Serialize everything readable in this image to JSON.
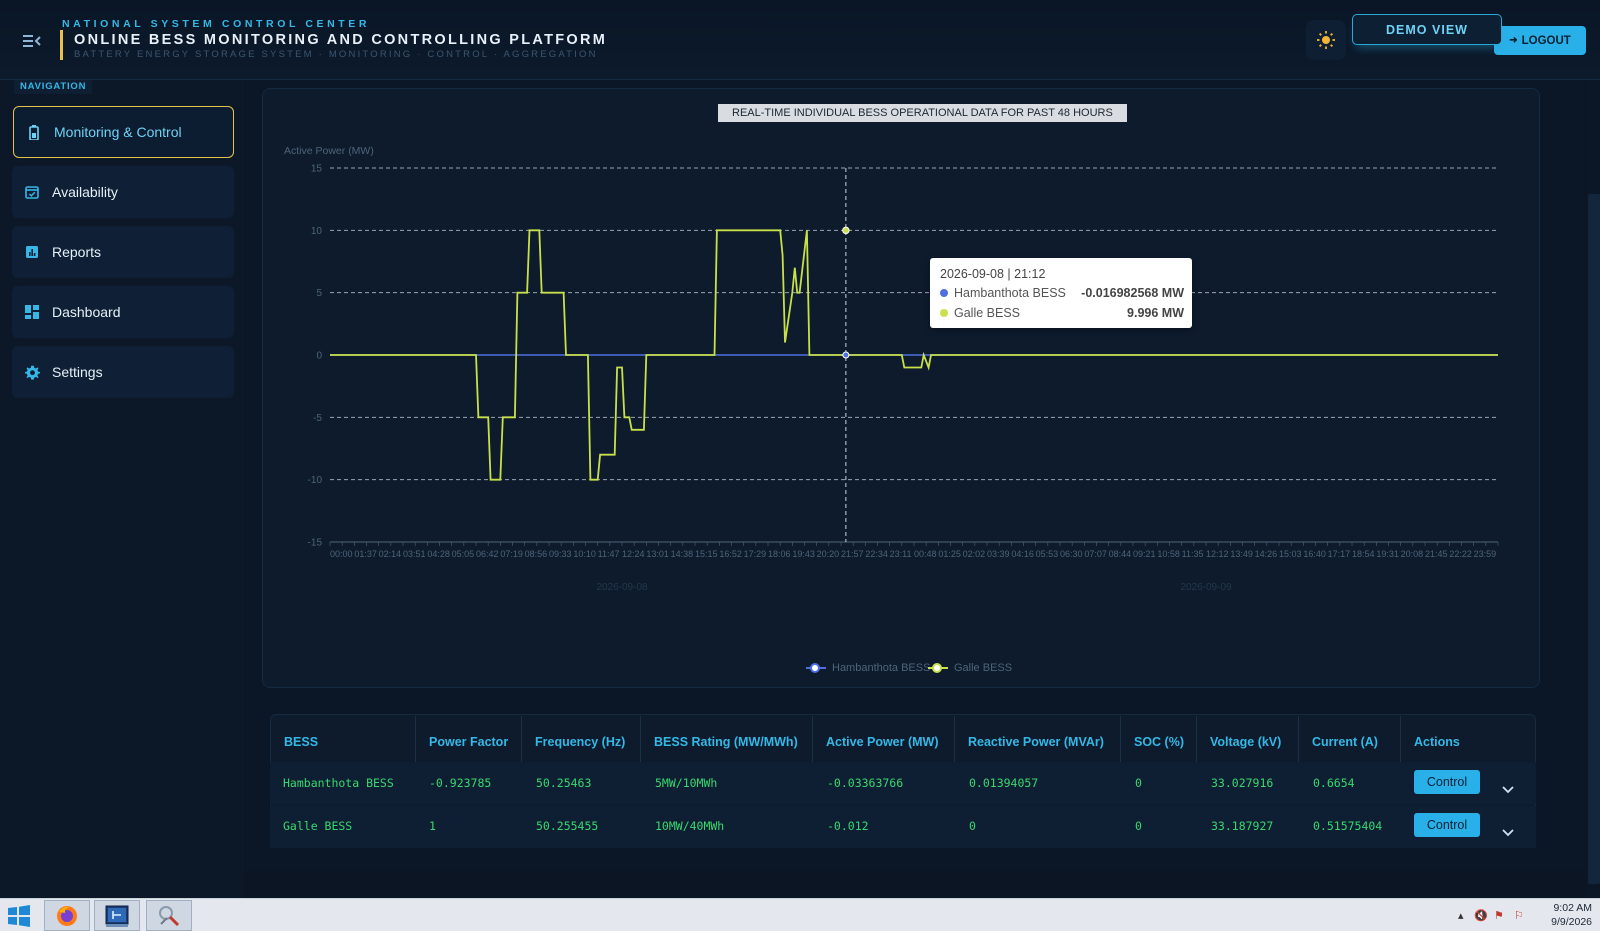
{
  "header": {
    "center_name": "NATIONAL SYSTEM CONTROL CENTER",
    "title": "ONLINE BESS MONITORING AND CONTROLLING PLATFORM",
    "subtitle": "BATTERY ENERGY STORAGE SYSTEM · MONITORING · CONTROL · AGGREGATION",
    "demo_label": "DEMO VIEW",
    "logout_label": "LOGOUT"
  },
  "sidebar": {
    "section_label": "NAVIGATION",
    "items": [
      {
        "label": "Monitoring & Control",
        "icon": "battery-icon",
        "active": true
      },
      {
        "label": "Availability",
        "icon": "calendar-check-icon",
        "active": false
      },
      {
        "label": "Reports",
        "icon": "report-chart-icon",
        "active": false
      },
      {
        "label": "Dashboard",
        "icon": "dashboard-grid-icon",
        "active": false
      },
      {
        "label": "Settings",
        "icon": "gear-icon",
        "active": false
      }
    ]
  },
  "chart_data": {
    "type": "line",
    "title": "REAL-TIME INDIVIDUAL BESS OPERATIONAL DATA FOR PAST 48 HOURS",
    "ylabel": "Active Power (MW)",
    "xlabel": "",
    "ylim": [
      -15,
      15
    ],
    "yticks": [
      15,
      10,
      5,
      0,
      -5,
      -10,
      -15
    ],
    "x_unit": "hours",
    "xlim": [
      0,
      48
    ],
    "date_labels": [
      {
        "label": "2026-09-08",
        "x": 12
      },
      {
        "label": "2026-09-09",
        "x": 36
      }
    ],
    "grid": true,
    "legend_position": "bottom",
    "series": [
      {
        "name": "Hambanthota BESS",
        "color": "#4f6fe0",
        "x": [
          0,
          48
        ],
        "y": [
          0,
          0
        ]
      },
      {
        "name": "Galle BESS",
        "color": "#c8e04a",
        "x": [
          0,
          6.0,
          6.1,
          6.5,
          6.6,
          7.0,
          7.1,
          7.6,
          7.7,
          8.1,
          8.2,
          8.6,
          8.7,
          9.6,
          9.7,
          10.1,
          10.2,
          10.6,
          10.7,
          11.0,
          11.1,
          11.7,
          11.8,
          12.0,
          12.1,
          12.3,
          12.4,
          12.9,
          13.0,
          13.4,
          13.5,
          14.2,
          15.8,
          15.9,
          18.5,
          18.6,
          18.7,
          19.0,
          19.1,
          19.2,
          19.3,
          19.6,
          19.7,
          23.5,
          23.6,
          24.3,
          24.4,
          24.6,
          24.7,
          48
        ],
        "y": [
          0,
          0,
          -5,
          -5,
          -10,
          -10,
          -5,
          -5,
          5,
          5,
          10,
          10,
          5,
          5,
          0,
          0,
          0,
          0,
          -10,
          -10,
          -8,
          -8,
          -1,
          -1,
          -5,
          -5,
          -6,
          -6,
          0,
          0,
          0,
          0,
          0,
          10,
          10,
          8,
          1,
          5,
          7,
          5,
          5,
          10,
          0,
          0,
          -1,
          -1,
          0,
          -1,
          0,
          0
        ]
      }
    ],
    "tooltip": {
      "time": "2026-09-08 | 21:12",
      "rows": [
        {
          "name": "Hambanthota BESS",
          "value": "-0.016982568 MW",
          "color": "#4f6fe0"
        },
        {
          "name": "Galle BESS",
          "value": "9.996 MW",
          "color": "#c8e04a"
        }
      ],
      "x": 21.2
    }
  },
  "table": {
    "columns": [
      "BESS",
      "Power Factor",
      "Frequency (Hz)",
      "BESS Rating (MW/MWh)",
      "Active Power (MW)",
      "Reactive Power (MVAr)",
      "SOC (%)",
      "Voltage (kV)",
      "Current (A)",
      "Actions"
    ],
    "rows": [
      {
        "name": "Hambanthota BESS",
        "pf": "-0.923785",
        "freq": "50.25463",
        "rating": "5MW/10MWh",
        "active": "-0.03363766",
        "reactive": "0.01394057",
        "soc": "0",
        "voltage": "33.027916",
        "current": "0.6654",
        "action": "Control"
      },
      {
        "name": "Galle BESS",
        "pf": "1",
        "freq": "50.255455",
        "rating": "10MW/40MWh",
        "active": "-0.012",
        "reactive": "0",
        "soc": "0",
        "voltage": "33.187927",
        "current": "0.51575404",
        "action": "Control"
      }
    ]
  },
  "taskbar": {
    "time": "9:02 AM",
    "date": "9/9/2026",
    "apps": [
      "windows-start-icon",
      "firefox-icon",
      "terminal-app-icon",
      "tools-app-icon"
    ]
  }
}
